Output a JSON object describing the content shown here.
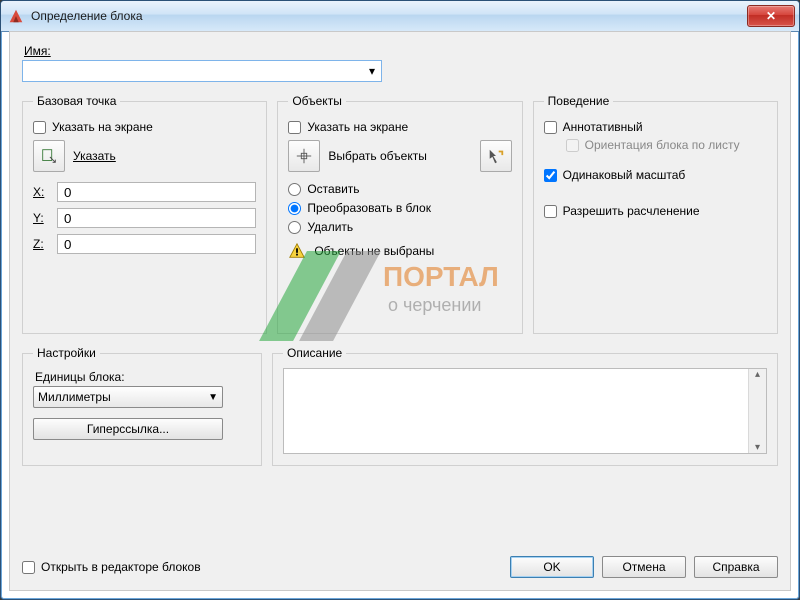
{
  "window": {
    "title": "Определение блока"
  },
  "name": {
    "label": "Имя:",
    "value": ""
  },
  "panels": {
    "base": {
      "legend": "Базовая точка",
      "specify": "Указать на экране",
      "pick": "Указать",
      "x_label": "X:",
      "x": "0",
      "y_label": "Y:",
      "y": "0",
      "z_label": "Z:",
      "z": "0"
    },
    "objects": {
      "legend": "Объекты",
      "specify": "Указать на экране",
      "select": "Выбрать объекты",
      "opt_keep": "Оставить",
      "opt_convert": "Преобразовать в блок",
      "opt_delete": "Удалить",
      "warn": "Объекты не выбраны"
    },
    "behavior": {
      "legend": "Поведение",
      "annotative": "Аннотативный",
      "orient": "Ориентация блока по листу",
      "scale": "Одинаковый масштаб",
      "explode": "Разрешить расчленение"
    },
    "settings": {
      "legend": "Настройки",
      "units_label": "Единицы блока:",
      "units_value": "Миллиметры",
      "hyperlink": "Гиперссылка..."
    },
    "description": {
      "legend": "Описание",
      "value": ""
    }
  },
  "footer": {
    "open_editor": "Открыть в редакторе блоков",
    "ok": "OK",
    "cancel": "Отмена",
    "help": "Справка"
  },
  "watermark": {
    "line1": "ПОРТАЛ",
    "line2": "о черчении"
  }
}
